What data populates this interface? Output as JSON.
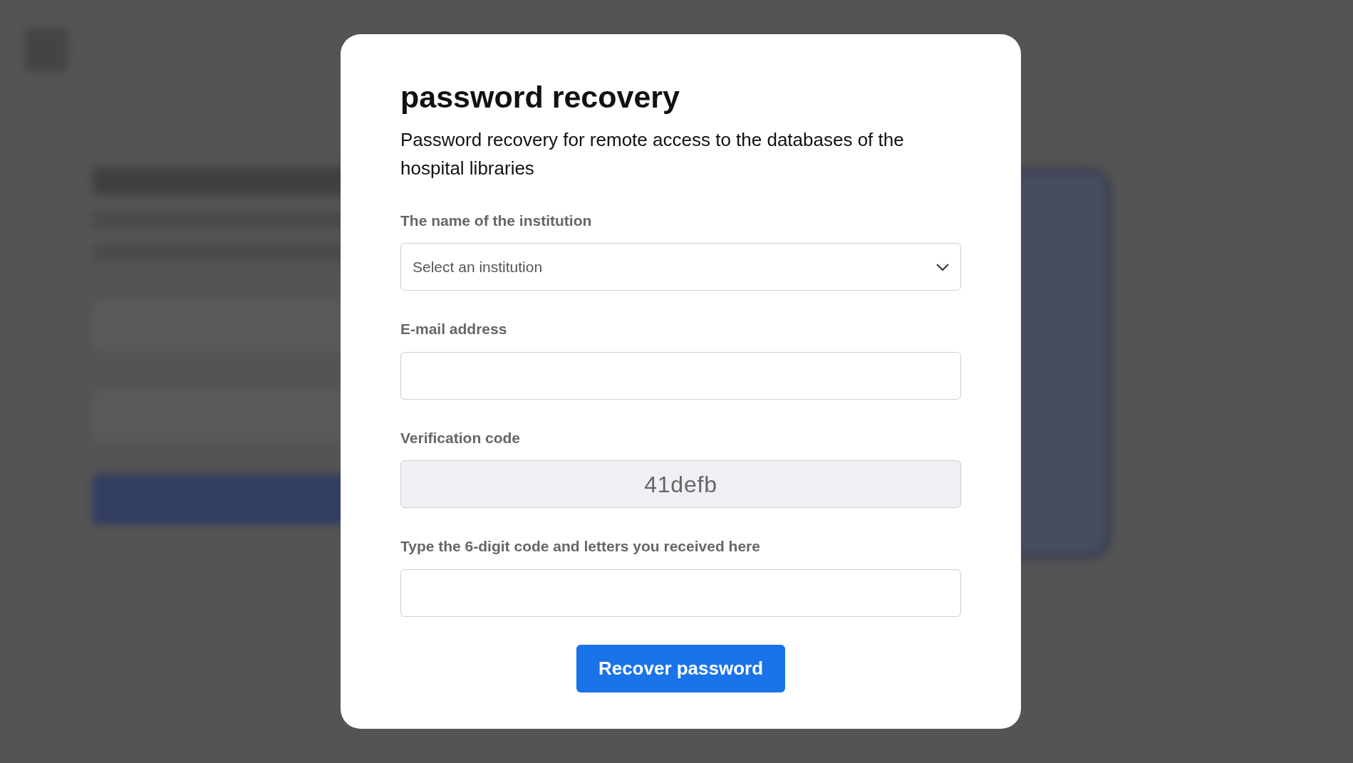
{
  "dialog": {
    "title": "password recovery",
    "description": "Password recovery for remote access to the databases of the hospital libraries",
    "fields": [
      {
        "kind": "select",
        "label": "The name of the institution",
        "placeholder": "Select an institution"
      },
      {
        "kind": "input",
        "label": "E-mail address"
      },
      {
        "kind": "captcha",
        "label": "Verification code",
        "value": "41defb"
      },
      {
        "kind": "input",
        "label": "Type the 6-digit code and letters you received here"
      }
    ],
    "button": "Recover password"
  }
}
